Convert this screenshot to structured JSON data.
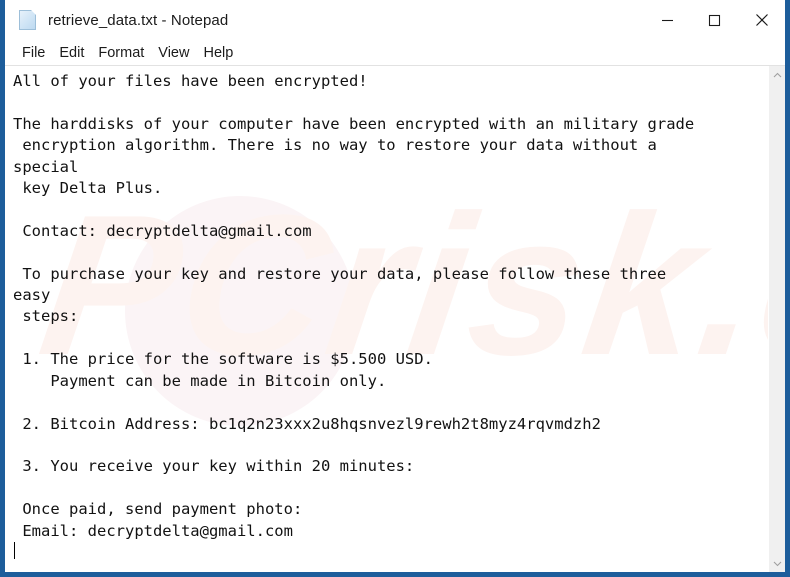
{
  "window": {
    "title": "retrieve_data.txt - Notepad",
    "icon": "notepad-document-icon",
    "border_color": "#1d5d9b",
    "controls": {
      "minimize": "minimize-icon",
      "maximize": "maximize-icon",
      "close": "close-icon"
    }
  },
  "menubar": {
    "items": [
      {
        "label": "File"
      },
      {
        "label": "Edit"
      },
      {
        "label": "Format"
      },
      {
        "label": "View"
      },
      {
        "label": "Help"
      }
    ]
  },
  "editor": {
    "content": "All of your files have been encrypted!\n\nThe harddisks of your computer have been encrypted with an military grade\n encryption algorithm. There is no way to restore your data without a\nspecial\n key Delta Plus.\n\n Contact: decryptdelta@gmail.com\n\n To purchase your key and restore your data, please follow these three\neasy\n steps:\n\n 1. The price for the software is $5.500 USD.\n    Payment can be made in Bitcoin only.\n\n 2. Bitcoin Address: bc1q2n23xxx2u8hqsnvezl9rewh2t8myz4rqvmdzh2\n\n 3. You receive your key within 20 minutes:\n\n Once paid, send payment photo:\n Email: decryptdelta@gmail.com\n",
    "details": {
      "headline": "All of your files have been encrypted!",
      "ransom_price": "$5.500 USD",
      "payment_method": "Bitcoin",
      "bitcoin_address": "bc1q2n23xxx2u8hqsnvezl9rewh2t8myz4rqvmdzh2",
      "contact_email": "decryptdelta@gmail.com",
      "key_name": "Delta Plus",
      "key_delivery_time": "20 minutes"
    },
    "watermark": "PCrisk.com"
  },
  "scrollbar": {
    "up_arrow": "chevron-up-icon",
    "down_arrow": "chevron-down-icon"
  }
}
